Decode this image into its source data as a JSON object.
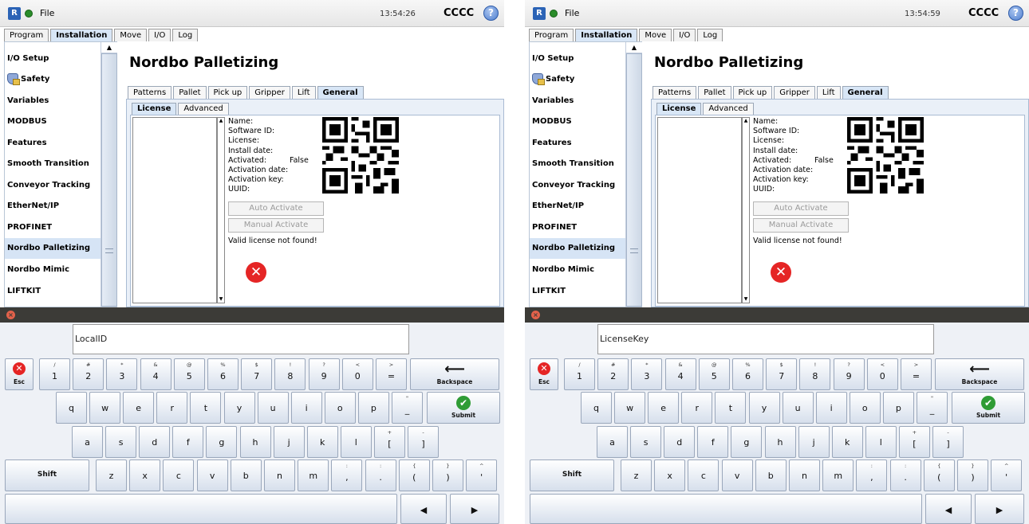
{
  "app": {
    "file_label": "File",
    "logo_label": "R",
    "robot_name": "CCCC",
    "help_label": "?",
    "main_tabs": [
      "Program",
      "Installation",
      "Move",
      "I/O",
      "Log"
    ]
  },
  "nav": {
    "items": [
      "I/O Setup",
      "Safety",
      "Variables",
      "MODBUS",
      "Features",
      "Smooth Transition",
      "Conveyor Tracking",
      "EtherNet/IP",
      "PROFINET",
      "Nordbo Palletizing",
      "Nordbo Mimic",
      "LIFTKIT"
    ],
    "selected": "Nordbo Palletizing"
  },
  "page": {
    "title": "Nordbo Palletizing",
    "sub_tabs": [
      "Patterns",
      "Pallet",
      "Pick up",
      "Gripper",
      "Lift",
      "General"
    ],
    "active_sub_tab": "General",
    "inner_tabs": [
      "License",
      "Advanced"
    ],
    "active_inner_tab": "License"
  },
  "license": {
    "labels": [
      "Name:",
      "Software ID:",
      "License:",
      "Install date:",
      "Activated:",
      "Activation date:",
      "Activation key:",
      "UUID:"
    ],
    "activated_value": "False",
    "auto_activate_label": "Auto Activate",
    "manual_activate_label": "Manual Activate",
    "status_text": "Valid license not found!",
    "error_glyph": "✕",
    "scroll_up_glyph": "▲",
    "scroll_down_glyph": "▼"
  },
  "keyboard": {
    "close_glyph": "×",
    "esc_glyph": "✕",
    "esc_label": "Esc",
    "backspace_label": "Backspace",
    "backspace_glyph": "⟵",
    "submit_label": "Submit",
    "submit_glyph": "✔",
    "shift_label": "Shift",
    "shift_glyph": "🡅",
    "left_arrow": "◀",
    "right_arrow": "▶",
    "number_row": [
      {
        "sym": "/",
        "main": "1"
      },
      {
        "sym": "#",
        "main": "2"
      },
      {
        "sym": "*",
        "main": "3"
      },
      {
        "sym": "&",
        "main": "4"
      },
      {
        "sym": "@",
        "main": "5"
      },
      {
        "sym": "%",
        "main": "6"
      },
      {
        "sym": "$",
        "main": "7"
      },
      {
        "sym": "!",
        "main": "8"
      },
      {
        "sym": "?",
        "main": "9"
      },
      {
        "sym": "<",
        "main": "0"
      },
      {
        "sym": ">",
        "main": "="
      }
    ],
    "row_q": [
      {
        "main": "q"
      },
      {
        "main": "w"
      },
      {
        "main": "e"
      },
      {
        "main": "r"
      },
      {
        "main": "t"
      },
      {
        "main": "y"
      },
      {
        "main": "u"
      },
      {
        "main": "i"
      },
      {
        "main": "o"
      },
      {
        "main": "p"
      },
      {
        "sym": "\"",
        "main": "_"
      }
    ],
    "row_a": [
      {
        "main": "a"
      },
      {
        "main": "s"
      },
      {
        "main": "d"
      },
      {
        "main": "f"
      },
      {
        "main": "g"
      },
      {
        "main": "h"
      },
      {
        "main": "j"
      },
      {
        "main": "k"
      },
      {
        "main": "l"
      },
      {
        "sym": "+",
        "main": "["
      },
      {
        "sym": "-",
        "main": "]"
      }
    ],
    "row_z": [
      {
        "main": "z"
      },
      {
        "main": "x"
      },
      {
        "main": "c"
      },
      {
        "main": "v"
      },
      {
        "main": "b"
      },
      {
        "main": "n"
      },
      {
        "main": "m"
      },
      {
        "sym": ":",
        "main": ","
      },
      {
        "sym": ":",
        "main": "."
      },
      {
        "sym": "{",
        "main": "("
      },
      {
        "sym": "}",
        "main": ")"
      },
      {
        "sym": "^",
        "main": "'"
      }
    ]
  },
  "screens": [
    {
      "time": "13:54:26",
      "input_value": "LocalID"
    },
    {
      "time": "13:54:59",
      "input_value": "LicenseKey"
    }
  ]
}
